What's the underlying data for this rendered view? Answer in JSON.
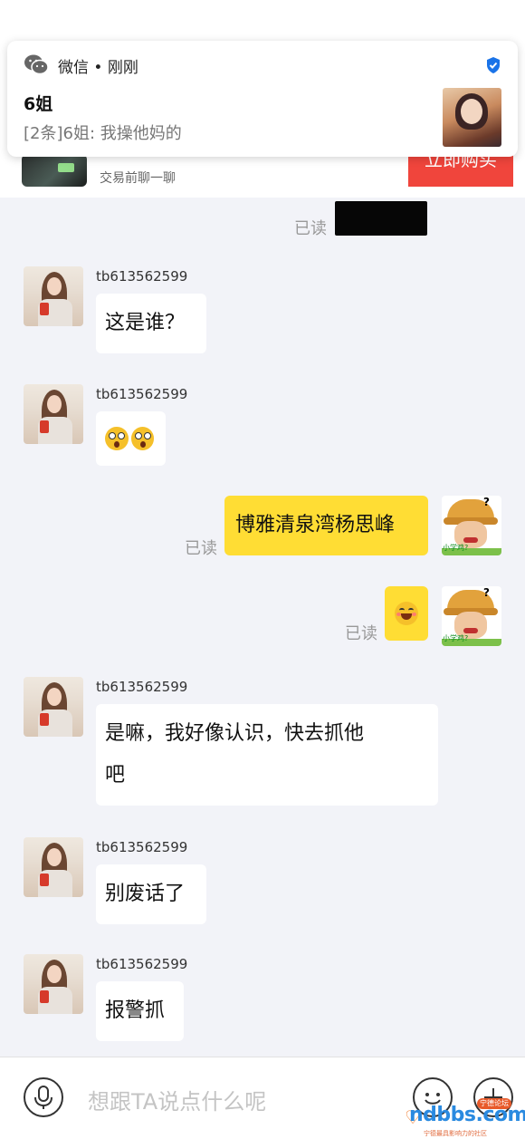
{
  "notification": {
    "app": "微信 • 刚刚",
    "title": "6姐",
    "body": "[2条]6姐: 我操他妈的"
  },
  "product": {
    "subtitle": "交易前聊一聊",
    "buy_label": "立即购买"
  },
  "colors": {
    "accent_yellow": "#ffdd34",
    "buy_red": "#f0453c",
    "bg": "#f2f3f8"
  },
  "chat": {
    "read_label": "已读",
    "messages": [
      {
        "from": "other",
        "name": "tb613562599",
        "text": "这是谁？"
      },
      {
        "from": "other",
        "name": "tb613562599",
        "emoji": [
          "astonished-emoji",
          "astonished-emoji"
        ]
      },
      {
        "from": "me",
        "text": "博雅清泉湾杨思峰",
        "read": "已读"
      },
      {
        "from": "me",
        "emoji": [
          "smile-emoji"
        ],
        "read": "已读"
      },
      {
        "from": "other",
        "name": "tb613562599",
        "text_line1": "是嘛，我好像认识，快去抓他",
        "text_line2": "吧"
      },
      {
        "from": "other",
        "name": "tb613562599",
        "text": "别废话了"
      },
      {
        "from": "other",
        "name": "tb613562599",
        "text": "报警抓"
      }
    ],
    "my_avatar_caption": "小学鸡?"
  },
  "input": {
    "placeholder": "想跟TA说点什么呢"
  },
  "watermark": {
    "text": "ndbbs.com",
    "badge": "宁德论坛",
    "sub": "宁德最具影响力的社区"
  }
}
